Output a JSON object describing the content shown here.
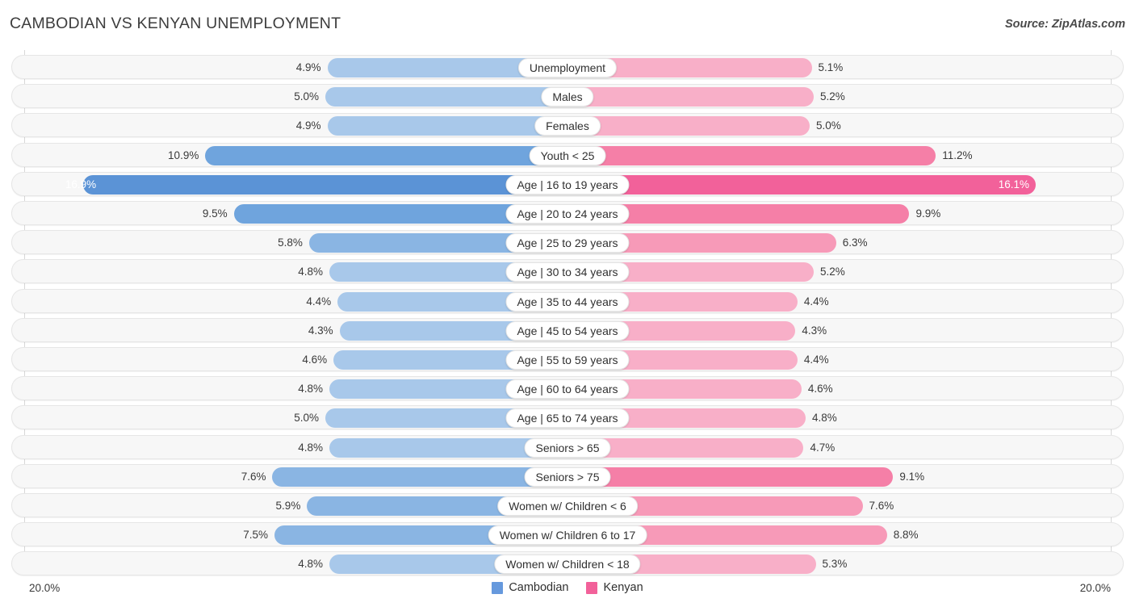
{
  "header": {
    "title": "CAMBODIAN VS KENYAN UNEMPLOYMENT",
    "source": "Source: ZipAtlas.com"
  },
  "axis": {
    "left_label": "20.0%",
    "right_label": "20.0%",
    "max": 20.0
  },
  "legend": {
    "items": [
      {
        "label": "Cambodian",
        "color": "#6699dd"
      },
      {
        "label": "Kenyan",
        "color": "#f2619a"
      }
    ]
  },
  "colors": {
    "left_light": "#a8c8ea",
    "left_mid": "#8ab5e3",
    "left_strong": "#6fa4dd",
    "left_max": "#5b93d6",
    "right_light": "#f8afc8",
    "right_mid": "#f79ab8",
    "right_strong": "#f57fa7",
    "right_max": "#f2619a",
    "track": "#f7f7f7",
    "gridline": "#d8d8d8"
  },
  "chart_data": {
    "type": "bar",
    "orientation": "horizontal-diverging",
    "title": "CAMBODIAN VS KENYAN UNEMPLOYMENT",
    "xlabel": "",
    "ylabel": "",
    "xlim": [
      20.0,
      20.0
    ],
    "grid": true,
    "legend_position": "bottom-center",
    "unit": "%",
    "categories": [
      "Unemployment",
      "Males",
      "Females",
      "Youth < 25",
      "Age | 16 to 19 years",
      "Age | 20 to 24 years",
      "Age | 25 to 29 years",
      "Age | 30 to 34 years",
      "Age | 35 to 44 years",
      "Age | 45 to 54 years",
      "Age | 55 to 59 years",
      "Age | 60 to 64 years",
      "Age | 65 to 74 years",
      "Seniors > 65",
      "Seniors > 75",
      "Women w/ Children < 6",
      "Women w/ Children 6 to 17",
      "Women w/ Children < 18"
    ],
    "series": [
      {
        "name": "Cambodian",
        "color": "#6699dd",
        "values": [
          4.9,
          5.0,
          4.9,
          10.9,
          16.9,
          9.5,
          5.8,
          4.8,
          4.4,
          4.3,
          4.6,
          4.8,
          5.0,
          4.8,
          7.6,
          5.9,
          7.5,
          4.8
        ]
      },
      {
        "name": "Kenyan",
        "color": "#f2619a",
        "values": [
          5.1,
          5.2,
          5.0,
          11.2,
          16.1,
          9.9,
          6.3,
          5.2,
          4.4,
          4.3,
          4.4,
          4.6,
          4.8,
          4.7,
          9.1,
          7.6,
          8.8,
          5.3
        ]
      }
    ]
  },
  "rows": [
    {
      "label": "Unemployment",
      "left": "4.9%",
      "right": "5.1%",
      "left_val": 4.9,
      "right_val": 5.1
    },
    {
      "label": "Males",
      "left": "5.0%",
      "right": "5.2%",
      "left_val": 5.0,
      "right_val": 5.2
    },
    {
      "label": "Females",
      "left": "4.9%",
      "right": "5.0%",
      "left_val": 4.9,
      "right_val": 5.0
    },
    {
      "label": "Youth < 25",
      "left": "10.9%",
      "right": "11.2%",
      "left_val": 10.9,
      "right_val": 11.2
    },
    {
      "label": "Age | 16 to 19 years",
      "left": "16.9%",
      "right": "16.1%",
      "left_val": 16.9,
      "right_val": 16.1
    },
    {
      "label": "Age | 20 to 24 years",
      "left": "9.5%",
      "right": "9.9%",
      "left_val": 9.5,
      "right_val": 9.9
    },
    {
      "label": "Age | 25 to 29 years",
      "left": "5.8%",
      "right": "6.3%",
      "left_val": 5.8,
      "right_val": 6.3
    },
    {
      "label": "Age | 30 to 34 years",
      "left": "4.8%",
      "right": "5.2%",
      "left_val": 4.8,
      "right_val": 5.2
    },
    {
      "label": "Age | 35 to 44 years",
      "left": "4.4%",
      "right": "4.4%",
      "left_val": 4.4,
      "right_val": 4.4
    },
    {
      "label": "Age | 45 to 54 years",
      "left": "4.3%",
      "right": "4.3%",
      "left_val": 4.3,
      "right_val": 4.3
    },
    {
      "label": "Age | 55 to 59 years",
      "left": "4.6%",
      "right": "4.4%",
      "left_val": 4.6,
      "right_val": 4.4
    },
    {
      "label": "Age | 60 to 64 years",
      "left": "4.8%",
      "right": "4.6%",
      "left_val": 4.8,
      "right_val": 4.6
    },
    {
      "label": "Age | 65 to 74 years",
      "left": "5.0%",
      "right": "4.8%",
      "left_val": 5.0,
      "right_val": 4.8
    },
    {
      "label": "Seniors > 65",
      "left": "4.8%",
      "right": "4.7%",
      "left_val": 4.8,
      "right_val": 4.7
    },
    {
      "label": "Seniors > 75",
      "left": "7.6%",
      "right": "9.1%",
      "left_val": 7.6,
      "right_val": 9.1
    },
    {
      "label": "Women w/ Children < 6",
      "left": "5.9%",
      "right": "7.6%",
      "left_val": 5.9,
      "right_val": 7.6
    },
    {
      "label": "Women w/ Children 6 to 17",
      "left": "7.5%",
      "right": "8.8%",
      "left_val": 7.5,
      "right_val": 8.8
    },
    {
      "label": "Women w/ Children < 18",
      "left": "4.8%",
      "right": "5.3%",
      "left_val": 4.8,
      "right_val": 5.3
    }
  ]
}
